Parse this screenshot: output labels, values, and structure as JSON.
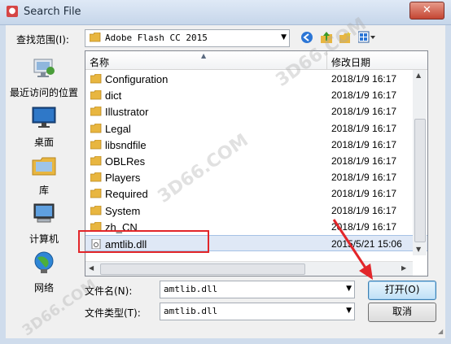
{
  "window": {
    "title": "Search File",
    "close_label": "✕"
  },
  "lookin": {
    "label": "查找范围(I):",
    "value": "Adobe Flash CC 2015"
  },
  "places": [
    {
      "label": "最近访问的位置",
      "icon": "recent-places-icon"
    },
    {
      "label": "桌面",
      "icon": "desktop-icon"
    },
    {
      "label": "库",
      "icon": "libraries-icon"
    },
    {
      "label": "计算机",
      "icon": "computer-icon"
    },
    {
      "label": "网络",
      "icon": "network-icon"
    }
  ],
  "filelist": {
    "columns": {
      "name": "名称",
      "date": "修改日期"
    },
    "rows": [
      {
        "name": "Configuration",
        "date": "2018/1/9 16:17",
        "type": "folder"
      },
      {
        "name": "dict",
        "date": "2018/1/9 16:17",
        "type": "folder"
      },
      {
        "name": "Illustrator",
        "date": "2018/1/9 16:17",
        "type": "folder"
      },
      {
        "name": "Legal",
        "date": "2018/1/9 16:17",
        "type": "folder"
      },
      {
        "name": "libsndfile",
        "date": "2018/1/9 16:17",
        "type": "folder"
      },
      {
        "name": "OBLRes",
        "date": "2018/1/9 16:17",
        "type": "folder"
      },
      {
        "name": "Players",
        "date": "2018/1/9 16:17",
        "type": "folder"
      },
      {
        "name": "Required",
        "date": "2018/1/9 16:17",
        "type": "folder"
      },
      {
        "name": "System",
        "date": "2018/1/9 16:17",
        "type": "folder"
      },
      {
        "name": "zh_CN",
        "date": "2018/1/9 16:17",
        "type": "folder"
      },
      {
        "name": "amtlib.dll",
        "date": "2015/5/21 15:06",
        "type": "dll"
      }
    ]
  },
  "filename": {
    "label": "文件名(N):",
    "value": "amtlib.dll"
  },
  "filetype": {
    "label": "文件类型(T):",
    "value": "amtlib.dll"
  },
  "buttons": {
    "open": "打开(O)",
    "cancel": "取消"
  },
  "watermarks": [
    "3D66.COM",
    "3D66.COM",
    "3D66.COM"
  ],
  "colors": {
    "highlight": "#e2262a",
    "folder": "#e8b640",
    "selection": "#dfe8f6"
  }
}
